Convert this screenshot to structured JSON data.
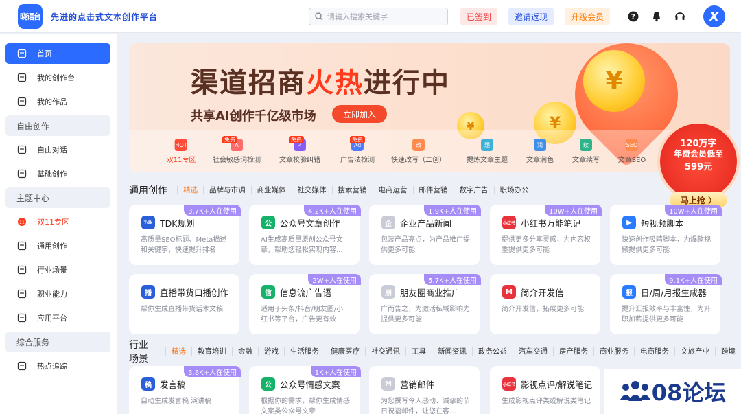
{
  "header": {
    "logo_text": "晓语台",
    "slogan": "先进的点击式文本创作平台",
    "search_placeholder": "请输入搜索关键字",
    "signed_label": "已签到",
    "invite_label": "邀请返现",
    "upgrade_label": "升级会员"
  },
  "sidebar": {
    "items": [
      {
        "label": "首页",
        "type": "item",
        "active": true
      },
      {
        "label": "我的创作台",
        "type": "item"
      },
      {
        "label": "我的作品",
        "type": "item"
      },
      {
        "label": "自由创作",
        "type": "section"
      },
      {
        "label": "自由对话",
        "type": "item"
      },
      {
        "label": "基础创作",
        "type": "item"
      },
      {
        "label": "主题中心",
        "type": "section"
      },
      {
        "label": "双11专区",
        "type": "item",
        "red": true
      },
      {
        "label": "通用创作",
        "type": "item"
      },
      {
        "label": "行业场景",
        "type": "item"
      },
      {
        "label": "职业能力",
        "type": "item"
      },
      {
        "label": "应用平台",
        "type": "item"
      },
      {
        "label": "综合服务",
        "type": "section"
      },
      {
        "label": "热点追踪",
        "type": "item"
      }
    ]
  },
  "banner": {
    "title_a": "渠道招商",
    "title_hot": "火热",
    "title_b": "进行中",
    "subtitle": "共享AI创作千亿级市场",
    "join_label": "立即加入",
    "coin_symbol": "¥",
    "free_tag": "免费",
    "nav": [
      {
        "label": "双11专区",
        "icon": "HOT"
      },
      {
        "label": "社会敏感词检测",
        "icon": "A"
      },
      {
        "label": "文章校验纠错",
        "icon": "✓"
      },
      {
        "label": "广告法检测",
        "icon": "Ad"
      },
      {
        "label": "快速改写（二创）",
        "icon": "改"
      },
      {
        "label": "提炼文章主题",
        "icon": "题"
      },
      {
        "label": "文章润色",
        "icon": "润"
      },
      {
        "label": "文章续写",
        "icon": "续"
      },
      {
        "label": "文章SEO",
        "icon": "SEO"
      }
    ]
  },
  "promo": {
    "line1": "120万字",
    "line2": "年费会员低至",
    "line3": "599元",
    "button": "马上抢 〉"
  },
  "general": {
    "title": "通用创作",
    "tabs": [
      "精选",
      "品牌与市调",
      "商业媒体",
      "社交媒体",
      "搜索营销",
      "电商运营",
      "邮件营销",
      "数字广告",
      "职场办公"
    ],
    "cards": [
      {
        "title": "TDK规划",
        "desc": "高质量SEO标题、Meta描述和关键字，快速提升排名",
        "badge": "3.7K+人在使用",
        "icon": "Tdk"
      },
      {
        "title": "公众号文章创作",
        "desc": "AI生成高质量原创公众号文章，帮助您轻松实现内容...",
        "badge": "4.2K+人在使用",
        "icon": "公"
      },
      {
        "title": "企业产品新闻",
        "desc": "包装产品亮点，为产品推广提供更多可能",
        "badge": "1.9K+人在使用",
        "icon": "企"
      },
      {
        "title": "小红书万能笔记",
        "desc": "提供更多分享灵感，为内容权重提供更多可能",
        "badge": "10W+人在使用",
        "icon": "小红书"
      },
      {
        "title": "短视频脚本",
        "desc": "快速创作吸睛脚本，为爆款视频提供更多可能",
        "badge": "10W+人在使用",
        "icon": "▶"
      },
      {
        "title": "直播带货口播创作",
        "desc": "帮你生成直播带货话术文稿",
        "badge": "",
        "icon": "播"
      },
      {
        "title": "信息流广告语",
        "desc": "适用于头条/抖音/朋友圈/小红书等平台，广告更有效",
        "badge": "2W+人在使用",
        "icon": "信"
      },
      {
        "title": "朋友圈商业推广",
        "desc": "广而告之，为激活私域影响力提供更多可能",
        "badge": "5.7K+人在使用",
        "icon": "朋"
      },
      {
        "title": "简介开发信",
        "desc": "简介开发信，拓展更多可能",
        "badge": "",
        "icon": "M"
      },
      {
        "title": "日/周/月报生成器",
        "desc": "提升汇报效率与丰富性，为升职加薪提供更多可能",
        "badge": "9.1K+人在使用",
        "icon": "报"
      }
    ]
  },
  "industry": {
    "title": "行业场景",
    "tabs": [
      "精选",
      "教育培训",
      "金融",
      "游戏",
      "生活服务",
      "健康医疗",
      "社交通讯",
      "工具",
      "新闻资讯",
      "政务公益",
      "汽车交通",
      "房产服务",
      "商业服务",
      "电商服务",
      "文旅产业",
      "跨境"
    ],
    "cards": [
      {
        "title": "发言稿",
        "desc": "自动生成发言稿 演讲稿",
        "badge": "3.8K+人在使用",
        "icon": "稿"
      },
      {
        "title": "公众号情感文案",
        "desc": "根据你的需求，帮你生成情感文案类公众号文章",
        "badge": "1K+人在使用",
        "icon": "公"
      },
      {
        "title": "营销邮件",
        "desc": "为您撰写令人感动、诚挚的节日祝福邮件，让您在客...",
        "badge": "",
        "icon": "M"
      },
      {
        "title": "影视点评/解说笔记",
        "desc": "生成影视点评类或解说类笔记",
        "badge": "",
        "icon": "小红书"
      }
    ]
  },
  "watermark": "08论坛"
}
